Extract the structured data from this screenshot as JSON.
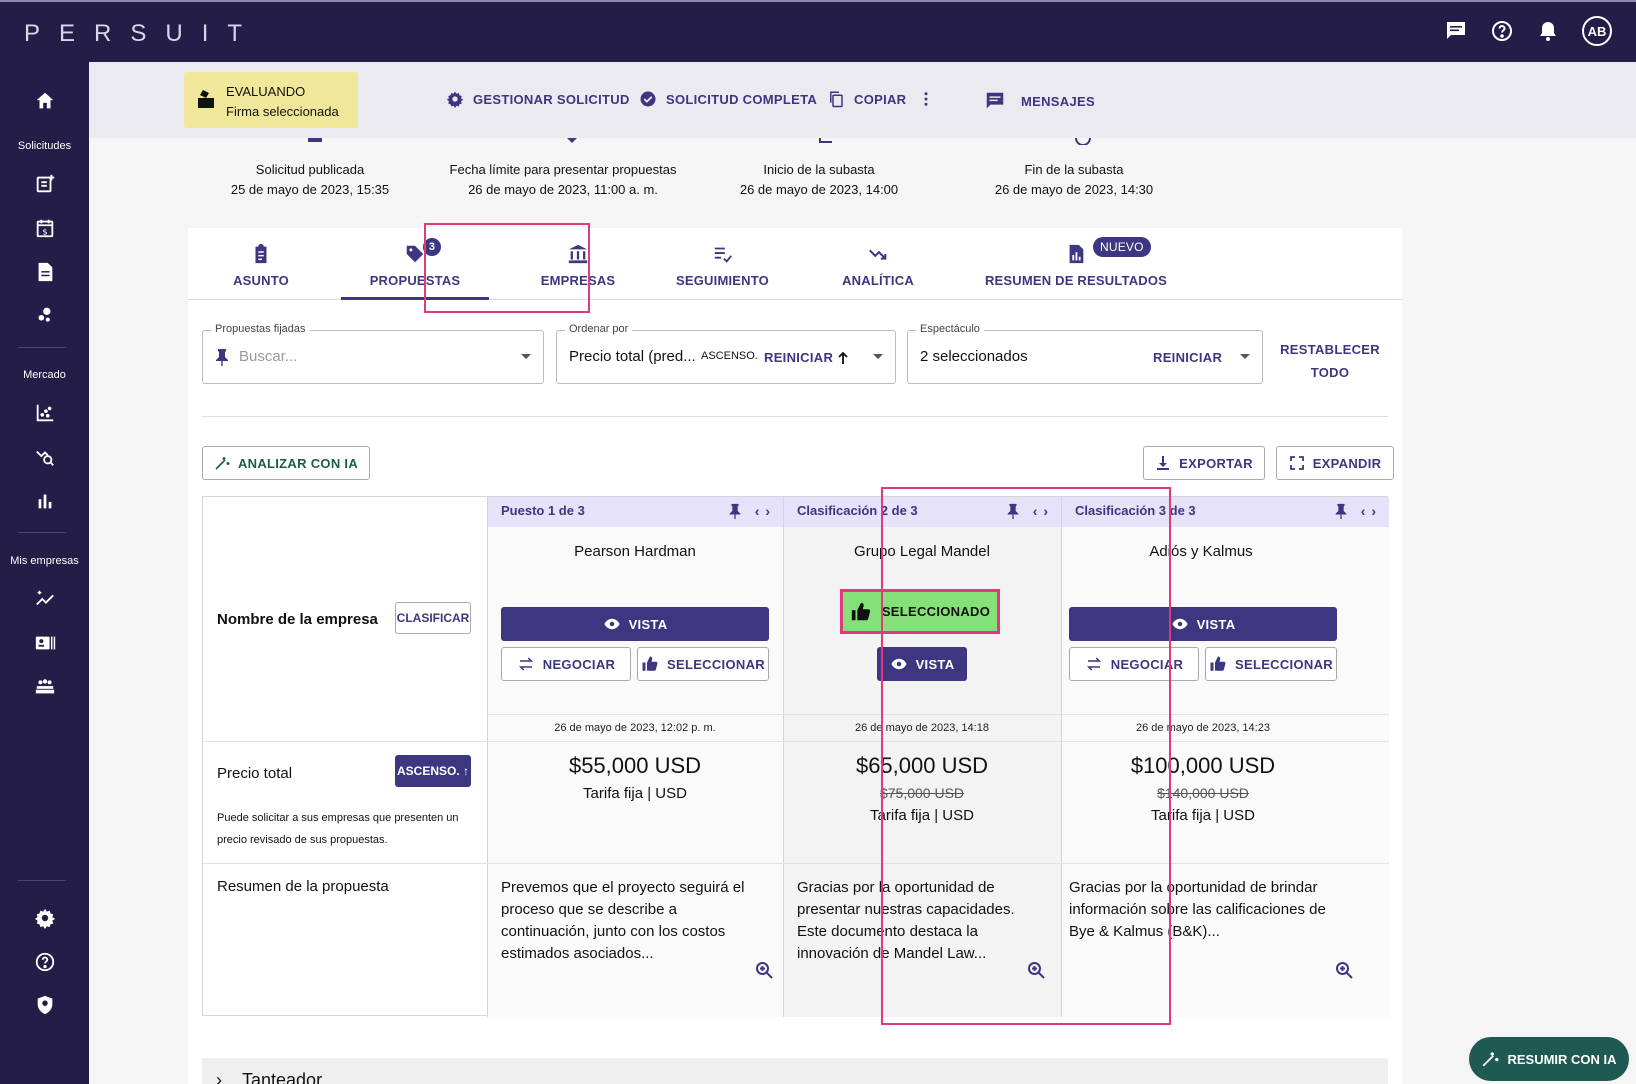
{
  "app": {
    "logo": "PERSUIT",
    "avatar_initials": "AB"
  },
  "sidebar": {
    "sections": [
      "Solicitudes",
      "Mercado",
      "Mis empresas"
    ]
  },
  "status": {
    "title": "EVALUANDO",
    "subtitle": "Firma seleccionada"
  },
  "actions": {
    "manage": "GESTIONAR SOLICITUD",
    "complete": "SOLICITUD COMPLETA",
    "copy": "COPIAR",
    "messages": "MENSAJES"
  },
  "milestones": [
    {
      "label": "Solicitud publicada",
      "date": "25 de mayo de 2023, 15:35"
    },
    {
      "label": "Fecha límite para presentar propuestas",
      "date": "26 de mayo de 2023, 11:00 a. m."
    },
    {
      "label": "Inicio de la subasta",
      "date": "26 de mayo de 2023, 14:00"
    },
    {
      "label": "Fin de la subasta",
      "date": "26 de mayo de 2023, 14:30"
    }
  ],
  "tabs": [
    {
      "label": "ASUNTO"
    },
    {
      "label": "PROPUESTAS",
      "badge": "3"
    },
    {
      "label": "EMPRESAS"
    },
    {
      "label": "SEGUIMIENTO"
    },
    {
      "label": "ANALÍTICA"
    },
    {
      "label": "RESUMEN DE RESULTADOS",
      "badge": "NUEVO"
    }
  ],
  "filters": {
    "pinned": {
      "label": "Propuestas fijadas",
      "placeholder": "Buscar..."
    },
    "sort": {
      "label": "Ordenar por",
      "value": "Precio total (pred...",
      "direction": "ASCENSO.",
      "reset": "REINICIAR"
    },
    "show": {
      "label": "Espectáculo",
      "value": "2 seleccionados",
      "reset": "REINICIAR"
    },
    "reset_all_1": "RESTABLECER",
    "reset_all_2": "TODO"
  },
  "toolbar": {
    "analyze": "ANALIZAR CON IA",
    "export": "EXPORTAR",
    "expand": "EXPANDIR"
  },
  "rows": {
    "firm_name": "Nombre de la empresa",
    "classify": "CLASIFICAR",
    "total_price": "Precio total",
    "asc": "ASCENSO.",
    "price_note_1": "Puede solicitar a sus empresas que presenten un",
    "price_note_2": "precio revisado de sus propuestas.",
    "summary": "Resumen de la propuesta"
  },
  "proposals": [
    {
      "rank": "Puesto 1 de 3",
      "firm": "Pearson Hardman",
      "view": "VISTA",
      "negotiate": "NEGOCIAR",
      "select": "SELECCIONAR",
      "date": "26 de mayo de 2023, 12:02 p. m.",
      "price": "$55,000 USD",
      "old_price": "",
      "fee": "Tarifa fija | USD",
      "summary_lines": [
        "Prevemos que el proyecto seguirá el",
        "proceso que se describe a",
        "continuación, junto con los costos",
        "estimados asociados..."
      ]
    },
    {
      "rank": "Clasificación 2 de 3",
      "firm": "Grupo Legal Mandel",
      "selected": "SELECCIONADO",
      "view": "VISTA",
      "date": "26 de mayo de 2023, 14:18",
      "price": "$65,000 USD",
      "old_price": "$75,000 USD",
      "fee": "Tarifa fija | USD",
      "summary_lines": [
        "Gracias por la oportunidad de",
        "presentar nuestras capacidades.",
        "Este documento destaca la",
        "innovación de Mandel Law..."
      ]
    },
    {
      "rank": "Clasificación 3 de 3",
      "firm": "Adiós y Kalmus",
      "view": "VISTA",
      "negotiate": "NEGOCIAR",
      "select": "SELECCIONAR",
      "date": "26 de mayo de 2023, 14:23",
      "price": "$100,000 USD",
      "old_price": "$140,000 USD",
      "fee": "Tarifa fija | USD",
      "summary_lines": [
        "Gracias por la oportunidad de brindar",
        "información sobre las calificaciones de",
        "Bye & Kalmus (B&K)..."
      ]
    }
  ],
  "scoreboard": "Tanteador",
  "fab": "RESUMIR CON IA",
  "colors": {
    "brand_dark": "#241d47",
    "accent": "#3d3680",
    "highlight": "#e2397e",
    "selected_green": "#86e07a",
    "status_yellow": "#f1e79a"
  }
}
